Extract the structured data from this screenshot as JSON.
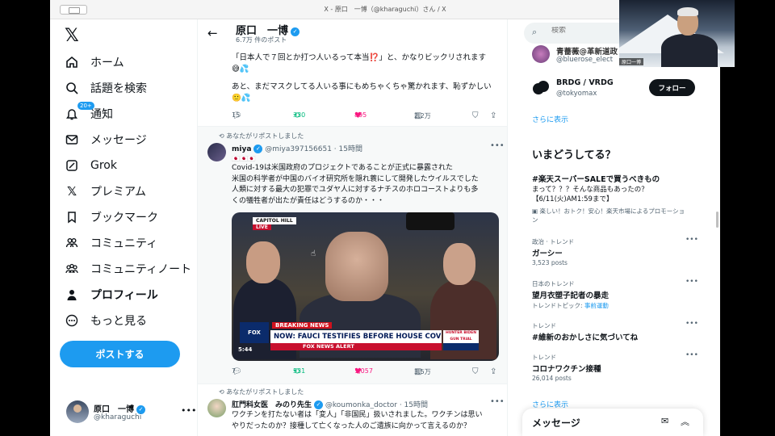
{
  "window": {
    "title": "X - 原口　一博（@kharaguchi）さん / X"
  },
  "nav": {
    "items": [
      {
        "label": "ホーム",
        "icon": "home-icon"
      },
      {
        "label": "話題を検索",
        "icon": "search-icon"
      },
      {
        "label": "通知",
        "icon": "bell-icon",
        "badge": "20+"
      },
      {
        "label": "メッセージ",
        "icon": "mail-icon"
      },
      {
        "label": "Grok",
        "icon": "grok-icon"
      },
      {
        "label": "プレミアム",
        "icon": "x-logo-icon"
      },
      {
        "label": "ブックマーク",
        "icon": "bookmark-icon"
      },
      {
        "label": "コミュニティ",
        "icon": "communities-icon"
      },
      {
        "label": "コミュニティノート",
        "icon": "community-notes-icon"
      },
      {
        "label": "プロフィール",
        "icon": "profile-icon"
      },
      {
        "label": "もっと見る",
        "icon": "more-circle-icon"
      }
    ],
    "post_button": "ポストする",
    "account": {
      "name": "原口　一博",
      "handle": "@kharaguchi"
    }
  },
  "profile_header": {
    "name": "原口　一博",
    "post_count": "6.7万 件のポスト"
  },
  "post1": {
    "text_line1": "「日本人で７回とか打つ人いるって本当⁉️」と、かなりビックリされます",
    "text_line2": "😅💦",
    "text_line3": "あと、まだマスクしてる人いる事にもめちゃくちゃ驚かれます、恥ずかしい",
    "text_line4": "🙂💦",
    "replies": "15",
    "reposts": "330",
    "likes": "895",
    "views": "2.2万"
  },
  "post2": {
    "repost_note": "あなたがリポストしました",
    "author": "miya",
    "handle": "@miya397156651",
    "time": "15時間",
    "flags": "🇯🇵🇯🇵🇯🇵",
    "text_lines": [
      "Covid-19は米国政府のプロジェクトであることが正式に暴露された",
      "米国の科学者が中国のバイオ研究所を隠れ蓑にして開発したウイルスでした",
      "人類に対する最大の犯罪でユダヤ人に対するナチスのホロコーストよりも多",
      "くの犠牲者が出たが責任はどうするのか・・・"
    ],
    "media": {
      "tag_hill": "CAPITOL HILL",
      "tag_live": "LIVE",
      "breaking": "BREAKING NEWS",
      "headline": "NOW: FAUCI TESTIFIES BEFORE HOUSE COVID SUBCMTE",
      "alert": "FOX NEWS ALERT",
      "logo": "FOX",
      "time": "5:44",
      "side": "HUNTER BIDEN GUN TRIAL"
    },
    "replies": "7",
    "reposts": "531",
    "likes": "1,057",
    "views": "3.5万"
  },
  "post3": {
    "repost_note": "あなたがリポストしました",
    "author": "肛門科女医　みのり先生",
    "handle": "@koumonka_doctor",
    "time": "15時間",
    "text_line1": "ワクチンを打たない者は「変人」「非国民」扱いされました。ワクチンは思い",
    "text_line2": "やりだったのか？接種して亡くなった人のご遺族に向かって言えるのか？"
  },
  "right": {
    "search_placeholder": "検索",
    "who": [
      {
        "name": "青薔薇@革新道政",
        "handle": "@bluerose_elect"
      },
      {
        "name": "BRDG / VRDG",
        "handle": "@tokyomax",
        "button": "フォロー"
      }
    ],
    "show_more": "さらに表示",
    "trends_title": "いまどうしてる？",
    "promo": {
      "name": "#楽天スーパーSALEで買うべきもの",
      "line1": "まって？？？そんな商品もあったの？",
      "line2": "【6/11(火)AM1:59まで】",
      "promoted_by": "楽しい！おトク！安心！楽天市場によるプロモーショ",
      "promoted_by2": "ン"
    },
    "trends": [
      {
        "category": "政治 · トレンド",
        "name": "ガーシー",
        "sub": "3,523 posts"
      },
      {
        "category": "日本のトレンド",
        "name": "望月衣塑子記者の暴走",
        "sub": "トレンドトピック: ",
        "sub_link": "事前運動"
      },
      {
        "category": "トレンド",
        "name": "#維新のおかしさに気づいてね",
        "sub": ""
      },
      {
        "category": "トレンド",
        "name": "コロナワクチン接種",
        "sub": "26,014 posts"
      }
    ],
    "show_more2": "さらに表示",
    "messages_title": "メッセージ"
  },
  "webcam": {
    "label": "原口一博"
  },
  "colors": {
    "accent": "#1d9bf0",
    "like": "#f91880",
    "repost": "#00ba7c",
    "text": "#0f1419",
    "muted": "#536471"
  }
}
